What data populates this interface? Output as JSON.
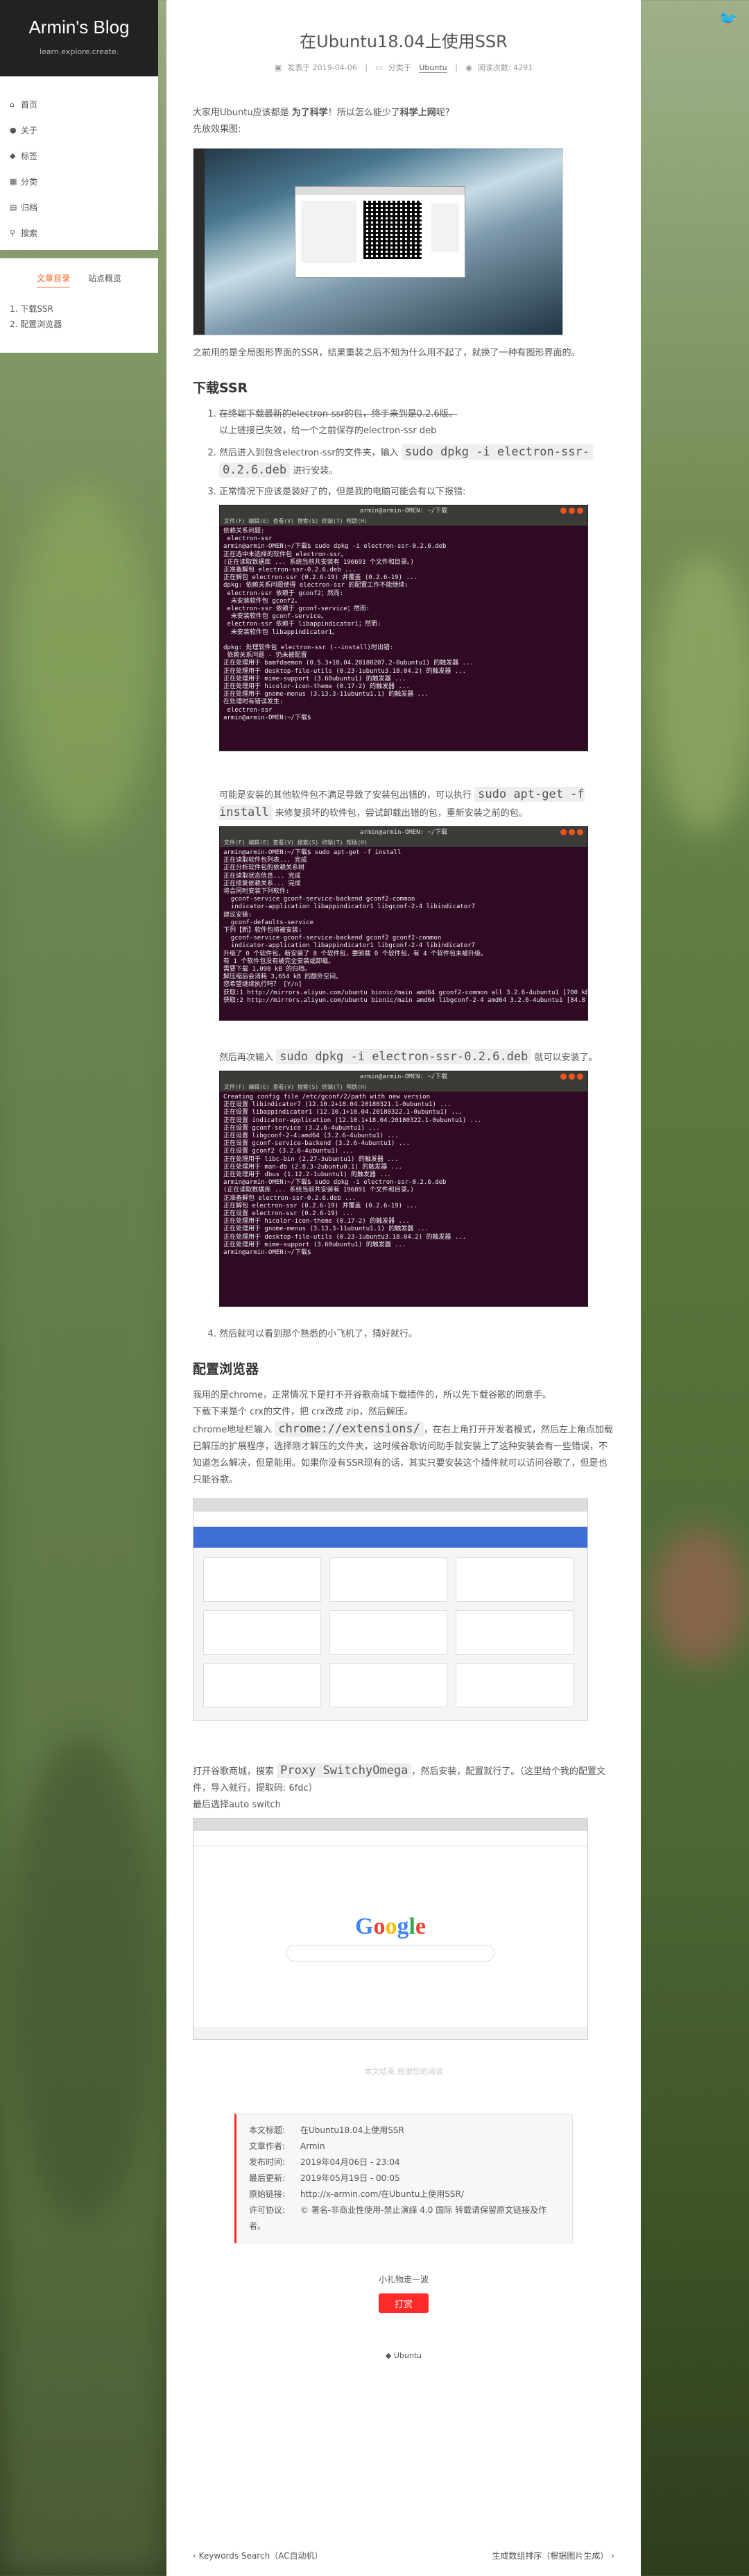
{
  "sidebar": {
    "brand_title": "Armin's Blog",
    "brand_subtitle": "learn.explore.create.",
    "menu": [
      {
        "label": "首页",
        "icon": "home-icon",
        "glyph": "⌂"
      },
      {
        "label": "关于",
        "icon": "user-icon",
        "glyph": "●"
      },
      {
        "label": "标签",
        "icon": "tags-icon",
        "glyph": "◆"
      },
      {
        "label": "分类",
        "icon": "th-icon",
        "glyph": "▦"
      },
      {
        "label": "归档",
        "icon": "archive-icon",
        "glyph": "▤"
      },
      {
        "label": "搜索",
        "icon": "search-icon",
        "glyph": "⚲"
      }
    ],
    "toc_tabs": [
      "文章目录",
      "站点概览"
    ],
    "toc_items": [
      "1. 下载SSR",
      "2. 配置浏览器"
    ]
  },
  "post": {
    "title": "在Ubuntu18.04上使用SSR",
    "meta_posted": "发表于 2019-04-06",
    "meta_category_prefix": "分类于",
    "meta_category": "Ubuntu",
    "meta_reading": "阅读次数: 4291",
    "intro_line1_a": "大家用Ubuntu应该都是 ",
    "intro_line1_b": "为了科学",
    "intro_line1_c": "！所以怎么能少了",
    "intro_line1_d": "科学上网",
    "intro_line1_e": "呢?",
    "intro_line2": "先放效果图:",
    "after_hero": "之前用的是全局图形界面的SSR，结果重装之后不知为什么用不起了，就换了一种有图形界面的。",
    "section1_heading": "下载SSR",
    "step1_strike": "在终端下载最新的electron-ssr的包，终于来到是0.2.6版。",
    "step1_sub": "以上链接已失效，给一个之前保存的electron-ssr deb",
    "step2_text": "然后进入到包含electron-ssr的文件夹，输入 ",
    "step2_code1": "sudo dpkg -i electron-ssr-",
    "step2_code2": "0.2.6.deb",
    "step2_tail": " 进行安装。",
    "step3_text": "正常情况下应该是装好了的，但是我的电脑可能会有以下报错:",
    "missing_deps_a": "可能是安装的其他软件包不满足导致了安装包出错的，可以执行 ",
    "missing_deps_code": "sudo apt-get -f install",
    "missing_deps_b": " 来修复损坏的软件包，尝试卸载出错的包，重新安装之前的包。",
    "reinstall_a": "然后再次输入 ",
    "reinstall_code": "sudo dpkg -i electron-ssr-0.2.6.deb",
    "reinstall_b": " 就可以安装了。",
    "step4_text": "然后就可以看到那个熟悉的小飞机了，猜好就行。",
    "section2_heading": "配置浏览器",
    "browser_p1": "我用的是chrome，正常情况下是打不开谷歌商城下载插件的，所以先下载谷歌的同意手。",
    "browser_p2": "下载下来是个 crx的文件，把 crx改成 zip，然后解压。",
    "browser_p3_a": "chrome地址栏输入 ",
    "browser_p3_code": "chrome://extensions/",
    "browser_p3_b": "，在右上角打开开发者模式，然后左上角点加载已解压的扩展程序，选择刚才解压的文件夹，这时候谷歌访问助手就安装上了这种安装会有一些错误，不知道怎么解决，但是能用。如果你没有SSR现有的话，其实只要安装这个插件就可以访问谷歌了，但是也只能谷歌。",
    "proxy_a": "打开谷歌商城，搜索 ",
    "proxy_code": "Proxy SwitchyOmega",
    "proxy_b": "，然后安装，配置就行了。（这里给个我的配置文件，导入就行，提取码: 6fdc）",
    "proxy_c": "最后选择auto switch",
    "end_text": "本文结束 感谢您的阅读",
    "google_logo": "Google"
  },
  "copyright": {
    "rows": [
      {
        "k": "本文标题:",
        "v": "在Ubuntu18.04上使用SSR"
      },
      {
        "k": "文章作者:",
        "v": "Armin"
      },
      {
        "k": "发布时间:",
        "v": "2019年04月06日 - 23:04"
      },
      {
        "k": "最后更新:",
        "v": "2019年05月19日 - 00:05"
      },
      {
        "k": "原始链接:",
        "v": "http://x-armin.com/在Ubuntu上使用SSR/"
      },
      {
        "k": "许可协议:",
        "v": "署名-非商业性使用-禁止演绎 4.0 国际 转载请保留原文链接及作者。"
      }
    ]
  },
  "reward": {
    "text": "小礼物走一波",
    "button": "打赏"
  },
  "tags": {
    "label": "Ubuntu"
  },
  "pager": {
    "prev": "Keywords Search（AC自动机）",
    "next": "生成数组排序（根据图片生成）"
  },
  "terminals": {
    "t1_title": "armin@armin-OMEN: ~/下载",
    "t1_menu": "文件(F)  编辑(E)  查看(V)  搜索(S)  终端(T)  帮助(H)",
    "t1_lines": "依赖关系问题:\n electron-ssr\narmin@armin-OMEN:~/下载$ sudo dpkg -i electron-ssr-0.2.6.deb\n正在选中未选择的软件包 electron-ssr。\n(正在读取数据库 ... 系统当前共安装有 196693 个文件和目录。)\n正准备解包 electron-ssr-0.2.6.deb ...\n正在解包 electron-ssr (0.2.6-19) 并覆盖 (0.2.6-19) ...\ndpkg: 依赖关系问题使得 electron-ssr 的配置工作不能继续:\n electron-ssr 依赖于 gconf2；然而:\n  未安装软件包 gconf2。\n electron-ssr 依赖于 gconf-service；然而:\n  未安装软件包 gconf-service。\n electron-ssr 依赖于 libappindicator1；然而:\n  未安装软件包 libappindicator1。\n\ndpkg: 处理软件包 electron-ssr (--install)时出错:\n 依赖关系问题 - 仍未被配置\n正在处理用于 bamfdaemon (0.5.3+18.04.20180207.2-0ubuntu1) 的触发器 ...\n正在处理用于 desktop-file-utils (0.23-1ubuntu3.18.04.2) 的触发器 ...\n正在处理用于 mime-support (3.60ubuntu1) 的触发器 ...\n正在处理用于 hicolor-icon-theme (0.17-2) 的触发器 ...\n正在处理用于 gnome-menus (3.13.3-11ubuntu1.1) 的触发器 ...\n在处理时有错误发生:\n electron-ssr\narmin@armin-OMEN:~/下载$",
    "t2_title": "armin@armin-OMEN: ~/下载",
    "t2_menu": "文件(F)  编辑(E)  查看(V)  搜索(S)  终端(T)  帮助(H)",
    "t2_lines": "armin@armin-OMEN:~/下载$ sudo apt-get -f install\n正在读取软件包列表... 完成\n正在分析软件包的依赖关系树\n正在读取状态信息... 完成\n正在修复依赖关系... 完成\n将会同时安装下列软件:\n  gconf-service gconf-service-backend gconf2-common\n  indicator-application libappindicator1 libgconf-2-4 libindicator7\n建议安装:\n  gconf-defaults-service\n下列【新】软件包将被安装:\n  gconf-service gconf-service-backend gconf2 gconf2-common\n  indicator-application libappindicator1 libgconf-2-4 libindicator7\n升级了 0 个软件包，新安装了 8 个软件包，要卸载 0 个软件包，有 4 个软件包未被升级。\n有 1 个软件包没有被完全安装或卸载。\n需要下载 1,098 kB 的归档。\n解压缩后会消耗 3,654 kB 的额外空间。\n您希望继续执行吗？ [Y/n]\n获取:1 http://mirrors.aliyun.com/ubuntu bionic/main amd64 gconf2-common all 3.2.6-4ubuntu1 [700 kB]\n获取:2 http://mirrors.aliyun.com/ubuntu bionic/main amd64 libgconf-2-4 amd64 3.2.6-4ubuntu1 [84.8 kB]",
    "t3_title": "armin@armin-OMEN: ~/下载",
    "t3_menu": "文件(F)  编辑(E)  查看(V)  搜索(S)  终端(T)  帮助(H)",
    "t3_lines": "Creating config file /etc/gconf/2/path with new version\n正在设置 libindicator7 (12.10.2+18.04.20180321.1-0ubuntu1) ...\n正在设置 libappindicator1 (12.10.1+18.04.20180322.1-0ubuntu1) ...\n正在设置 indicator-application (12.10.1+18.04.20180322.1-0ubuntu1) ...\n正在设置 gconf-service (3.2.6-4ubuntu1) ...\n正在设置 libgconf-2-4:amd64 (3.2.6-4ubuntu1) ...\n正在设置 gconf-service-backend (3.2.6-4ubuntu1) ...\n正在设置 gconf2 (3.2.6-4ubuntu1) ...\n正在处理用于 libc-bin (2.27-3ubuntu1) 的触发器 ...\n正在处理用于 man-db (2.8.3-2ubuntu0.1) 的触发器 ...\n正在处理用于 dbus (1.12.2-1ubuntu1) 的触发器 ...\narmin@armin-OMEN:~/下载$ sudo dpkg -i electron-ssr-0.2.6.deb\n(正在读取数据库 ... 系统当前共安装有 196891 个文件和目录。)\n正准备解包 electron-ssr-0.2.6.deb ...\n正在解包 electron-ssr (0.2.6-19) 并覆盖 (0.2.6-19) ...\n正在设置 electron-ssr (0.2.6-19) ...\n正在处理用于 hicolor-icon-theme (0.17-2) 的触发器 ...\n正在处理用于 gnome-menus (3.13.3-11ubuntu1.1) 的触发器 ...\n正在处理用于 desktop-file-utils (0.23-1ubuntu3.18.04.2) 的触发器 ...\n正在处理用于 mime-support (3.60ubuntu1) 的触发器 ...\narmin@armin-OMEN:~/下载$"
  },
  "colors": {
    "accent": "#fc6423",
    "reward": "#ff2a2a",
    "terminal_bg": "#300a24"
  }
}
